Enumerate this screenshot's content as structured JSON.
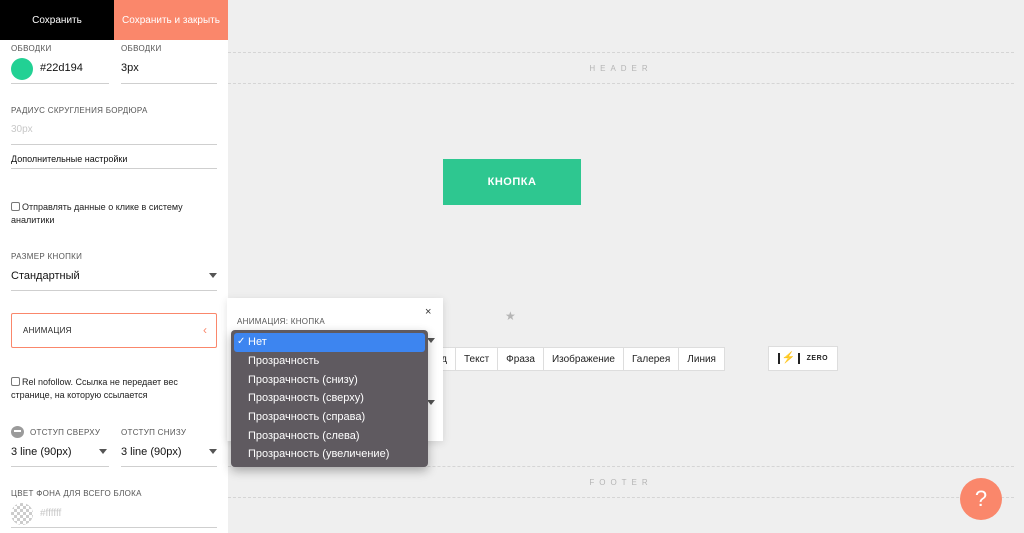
{
  "panel": {
    "save_label": "Сохранить",
    "save_close_label": "Сохранить и закрыть",
    "border_color_label": "ОБВОДКИ",
    "border_color_value": "#22d194",
    "border_width_label": "ОБВОДКИ",
    "border_width_value": "3px",
    "radius_label": "РАДИУС СКРУГЛЕНИЯ БОРДЮРА",
    "radius_placeholder": "30px",
    "extra_settings_label": "Дополнительные настройки",
    "analytics_text": "Отправлять данные о клике в систему аналитики",
    "size_label": "РАЗМЕР КНОПКИ",
    "size_value": "Стандартный",
    "animation_label": "АНИМАЦИЯ",
    "animation_chevron": "‹",
    "nofollow_text": "Rel nofollow. Ссылка не передает вес странице, на которую ссылается",
    "padding_top_label": "ОТСТУП СВЕРХУ",
    "padding_top_value": "3 line (90px)",
    "padding_bottom_label": "ОТСТУП СНИЗУ",
    "padding_bottom_value": "3 line (90px)",
    "bg_color_label": "ЦВЕТ ФОНА ДЛЯ ВСЕГО БЛОКА",
    "bg_color_placeholder": "#ffffff"
  },
  "canvas": {
    "header_label": "HEADER",
    "footer_label": "FOOTER",
    "button_label": "КНОПКА",
    "star": "★",
    "toolbar": [
      "Лид",
      "Текст",
      "Фраза",
      "Изображение",
      "Галерея",
      "Линия"
    ],
    "zero_icon": "⚡",
    "zero_label": "ZERO",
    "help_label": "?"
  },
  "popup": {
    "title": "АНИМАЦИЯ: КНОПКА",
    "close": "×"
  },
  "dropdown": {
    "check": "✓",
    "options": [
      "Нет",
      "Прозрачность",
      "Прозрачность (снизу)",
      "Прозрачность (сверху)",
      "Прозрачность (справа)",
      "Прозрачность (слева)",
      "Прозрачность (увеличение)"
    ]
  },
  "colors": {
    "accent": "#fa876b",
    "button_green": "#2ec790",
    "border_color": "#22d194",
    "selection_blue": "#3d85f0"
  }
}
